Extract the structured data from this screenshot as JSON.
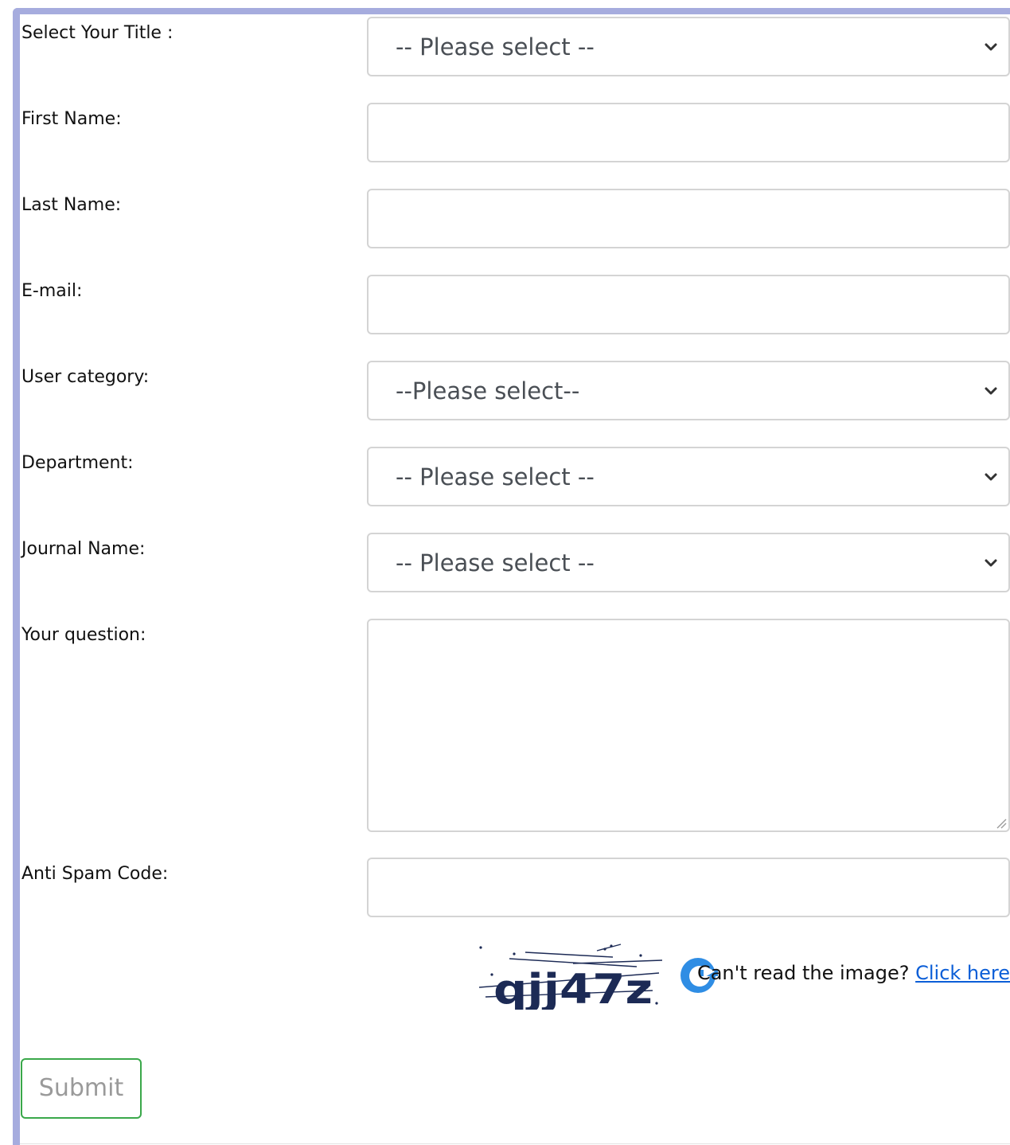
{
  "form": {
    "title": {
      "label": "Select Your Title :",
      "selected": "-- Please select --"
    },
    "first_name": {
      "label": "First Name:",
      "value": ""
    },
    "last_name": {
      "label": "Last Name:",
      "value": ""
    },
    "email": {
      "label": "E-mail:",
      "value": ""
    },
    "user_category": {
      "label": "User category:",
      "selected": "--Please select--"
    },
    "department": {
      "label": "Department:",
      "selected": "-- Please select --"
    },
    "journal_name": {
      "label": "Journal Name:",
      "selected": "-- Please select --"
    },
    "question": {
      "label": "Your question:",
      "value": ""
    },
    "anti_spam": {
      "label": "Anti Spam Code:",
      "value": ""
    },
    "captcha": {
      "image_text": "qjj47z",
      "cant_read": "Can't read the image?",
      "click_here": "Click here"
    },
    "submit_label": "Submit"
  },
  "colors": {
    "panel_border": "#a6acde",
    "submit_border": "#3aa84a",
    "link": "#0b5ed7",
    "captcha_ink": "#1c2a55",
    "refresh": "#2f8de4"
  },
  "icons": {
    "select_arrow": "chevron-down-icon",
    "refresh": "refresh-icon",
    "resize": "resize-grip-icon"
  }
}
